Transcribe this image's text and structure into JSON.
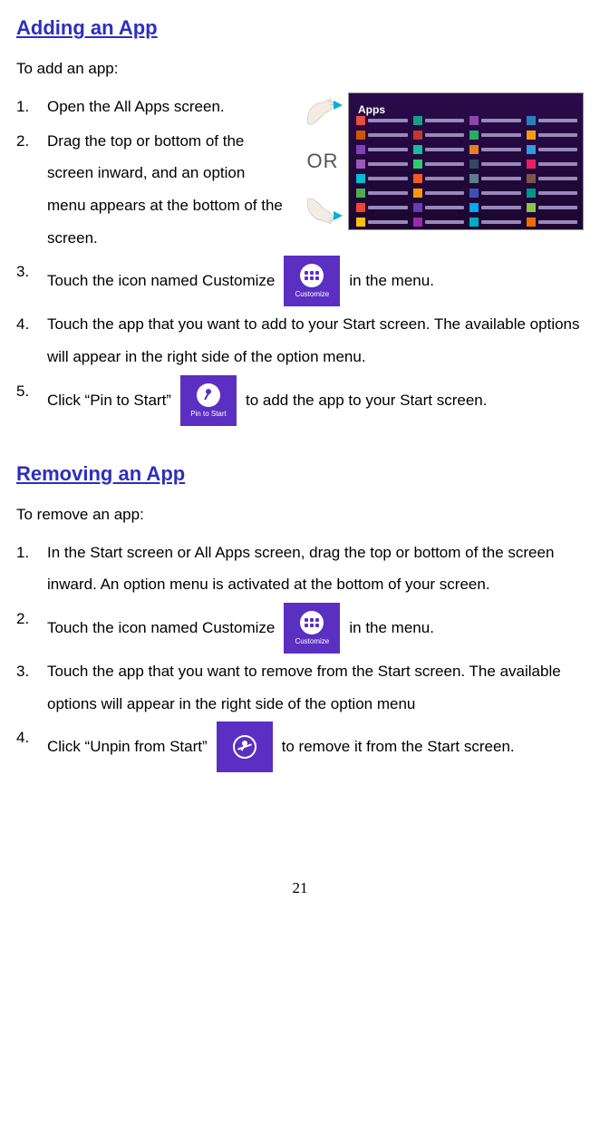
{
  "page_number": "21",
  "adding": {
    "heading": "Adding an App",
    "intro": "To add an app:",
    "steps": {
      "s1": "Open the All Apps screen.",
      "s2": "Drag the top or bottom of the screen inward, and an option menu appears at the bottom of the screen.",
      "s3_pre": "Touch the icon named Customize",
      "s3_post": "in the menu.",
      "s4": "Touch the app that you want to add to your Start screen. The available options will appear in the right side of the option menu.",
      "s5_pre": "Click “Pin to Start”",
      "s5_post": "to add the app to your Start screen."
    }
  },
  "removing": {
    "heading": "Removing an App",
    "intro": "To remove an app:",
    "steps": {
      "s1": "In the Start screen or All Apps screen, drag the top or bottom of the screen inward. An option menu is activated at the bottom of your screen.",
      "s2_pre": "Touch the icon named Customize",
      "s2_post": "in the menu.",
      "s3": "Touch the app that you want to remove from the Start screen. The available options will appear in the right side of the option menu",
      "s4_pre": "Click “Unpin from Start”",
      "s4_post": "to remove it from the Start screen."
    }
  },
  "figure": {
    "or_label": "OR",
    "apps_title": "Apps"
  },
  "icons": {
    "customize_caption": "Customize",
    "pin_caption": "Pin to Start"
  },
  "tile_colors": [
    "#e74c3c",
    "#16a085",
    "#8e44ad",
    "#2980b9",
    "#d35400",
    "#c0392b",
    "#27ae60",
    "#f39c12",
    "#7f3fbf",
    "#1abc9c",
    "#e67e22",
    "#3498db",
    "#9b59b6",
    "#2ecc71",
    "#34495e",
    "#e91e63",
    "#00bcd4",
    "#ff5722",
    "#607d8b",
    "#795548",
    "#4caf50",
    "#ff9800",
    "#3f51b5",
    "#009688",
    "#f44336",
    "#673ab7",
    "#03a9f4",
    "#8bc34a",
    "#ffc107",
    "#9c27b0",
    "#00acc1",
    "#ef6c00"
  ]
}
